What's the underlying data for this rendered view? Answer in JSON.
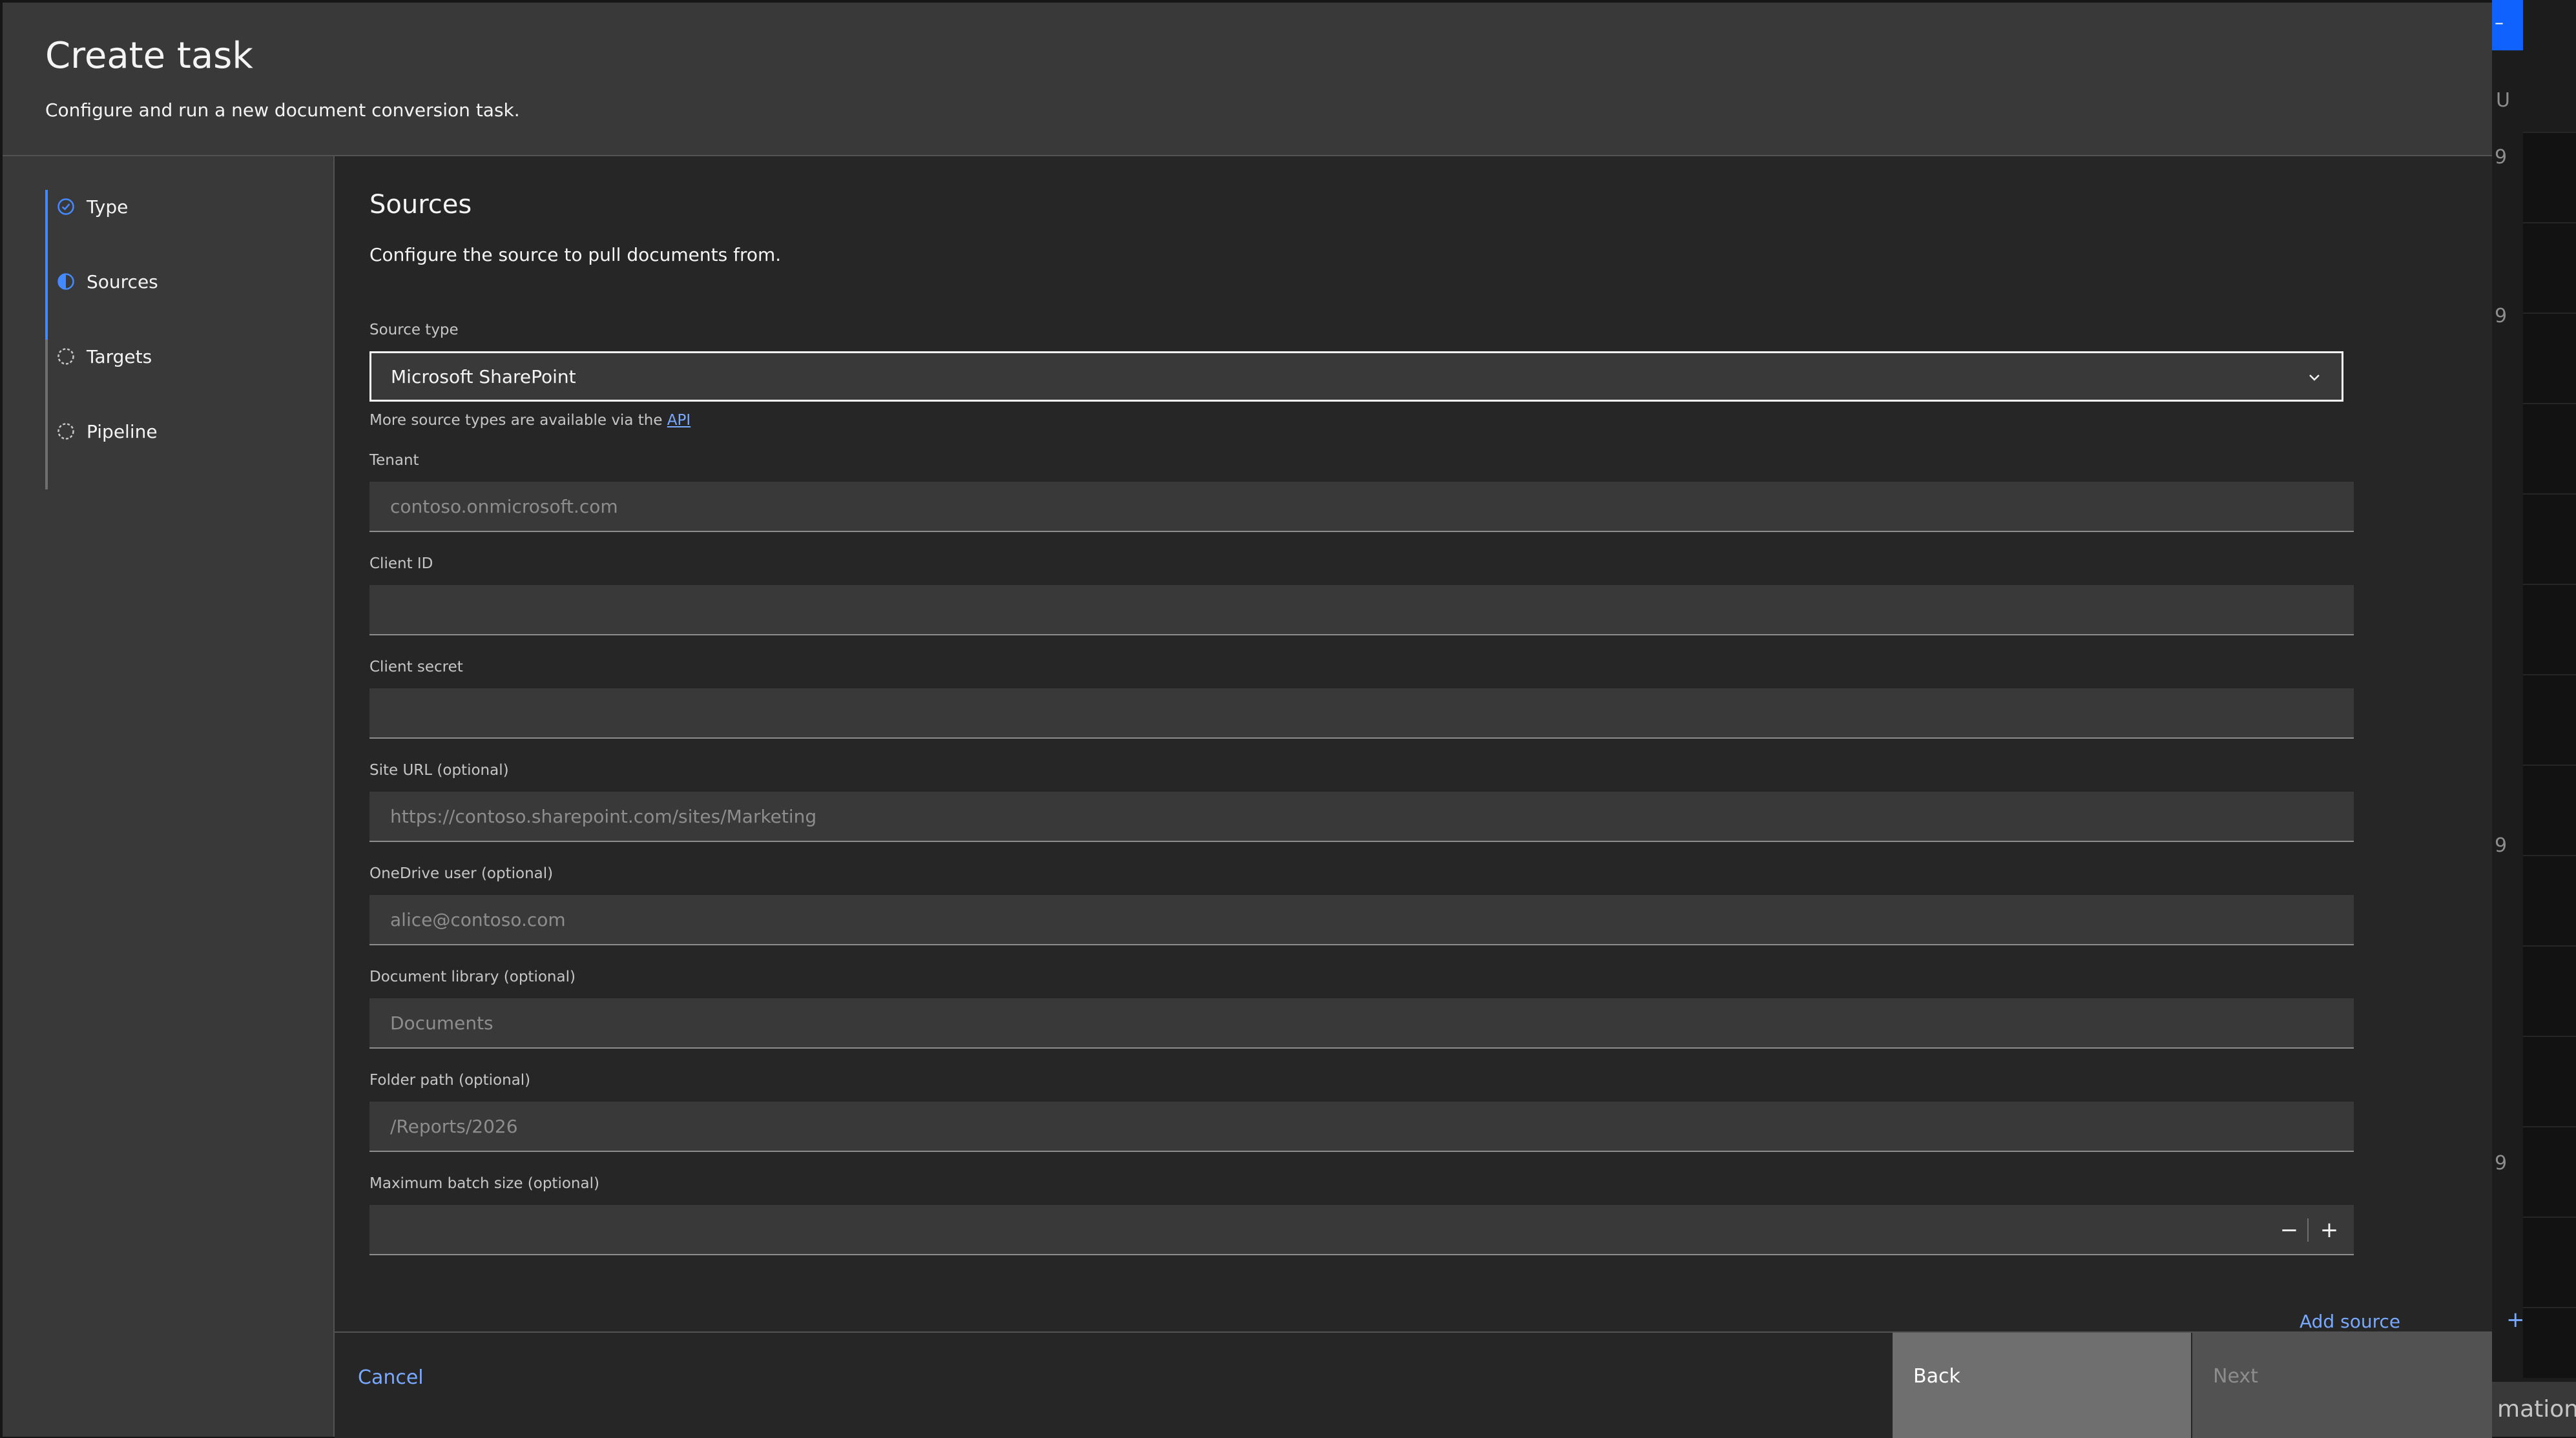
{
  "background_app": {
    "header_label": "U",
    "row_values": [
      "9",
      "9",
      "9",
      "9"
    ],
    "bottom_button_text": "mation",
    "accent_color": "#0f62fe"
  },
  "modal": {
    "title": "Create task",
    "subtitle": "Configure and run a new document conversion task."
  },
  "progress": {
    "steps": [
      {
        "label": "Type",
        "state": "complete",
        "icon": "checkmark-circle-icon"
      },
      {
        "label": "Sources",
        "state": "current",
        "icon": "half-filled-circle-icon"
      },
      {
        "label": "Targets",
        "state": "incomplete",
        "icon": "dashed-circle-icon"
      },
      {
        "label": "Pipeline",
        "state": "incomplete",
        "icon": "dashed-circle-icon"
      }
    ]
  },
  "section": {
    "title": "Sources",
    "description": "Configure the source to pull documents from."
  },
  "source_type": {
    "label": "Source type",
    "value": "Microsoft SharePoint",
    "helper_prefix": "More source types are available via the ",
    "helper_link": "API"
  },
  "fields": {
    "tenant": {
      "label": "Tenant",
      "placeholder": "contoso.onmicrosoft.com",
      "value": ""
    },
    "client_id": {
      "label": "Client ID",
      "placeholder": "",
      "value": ""
    },
    "client_secret": {
      "label": "Client secret",
      "placeholder": "",
      "value": ""
    },
    "site_url": {
      "label": "Site URL (optional)",
      "placeholder": "https://contoso.sharepoint.com/sites/Marketing",
      "value": ""
    },
    "onedrive_user": {
      "label": "OneDrive user (optional)",
      "placeholder": "alice@contoso.com",
      "value": ""
    },
    "document_library": {
      "label": "Document library (optional)",
      "placeholder": "Documents",
      "value": ""
    },
    "folder_path": {
      "label": "Folder path (optional)",
      "placeholder": "/Reports/2026",
      "value": ""
    },
    "max_batch": {
      "label": "Maximum batch size (optional)",
      "value": "",
      "decrement": "−",
      "increment": "+"
    }
  },
  "add_source": {
    "label": "Add source",
    "icon": "+"
  },
  "footer": {
    "cancel": "Cancel",
    "back": "Back",
    "next": "Next"
  },
  "colors": {
    "link": "#78a9ff",
    "progress_active": "#4589ff",
    "modal_header_bg": "#393939",
    "modal_body_bg": "#262626"
  }
}
